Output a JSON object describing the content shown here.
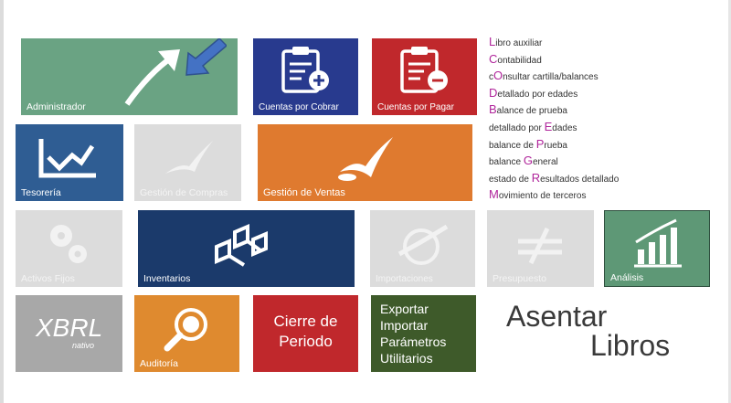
{
  "tiles": {
    "administrador": {
      "label": "Administrador",
      "color": "#6aa383"
    },
    "cuentas_cobrar": {
      "label": "Cuentas por Cobrar",
      "color": "#283a8e"
    },
    "cuentas_pagar": {
      "label": "Cuentas por Pagar",
      "color": "#c0282c"
    },
    "tesoreria": {
      "label": "Tesorería",
      "color": "#2f5d93"
    },
    "gestion_compras": {
      "label": "Gestión de Compras",
      "color": "#dcdcdc"
    },
    "gestion_ventas": {
      "label": "Gestión de Ventas",
      "color": "#df7a2f"
    },
    "activos_fijos": {
      "label": "Activos Fijos",
      "color": "#dcdcdc"
    },
    "inventarios": {
      "label": "Inventarios",
      "color": "#1b3a6b"
    },
    "importaciones": {
      "label": "Importaciones",
      "color": "#dcdcdc"
    },
    "presupuesto": {
      "label": "Presupuesto",
      "color": "#dcdcdc"
    },
    "analisis": {
      "label": "Análisis",
      "color": "#5e9876"
    },
    "xbrl": {
      "label": "XBRL",
      "sublabel": "nativo",
      "color": "#a8a8a8"
    },
    "auditoria": {
      "label": "Auditoría",
      "color": "#df8a2f"
    },
    "cierre": {
      "line1": "Cierre de",
      "line2": "Periodo",
      "color": "#c0282c"
    },
    "exportar": {
      "line1": "Exportar",
      "line2": "Importar",
      "line3": "Parámetros",
      "line4": "Utilitarios",
      "color": "#3e5a2a"
    }
  },
  "shortcuts": [
    {
      "pre": "",
      "key": "L",
      "post": "ibro auxiliar"
    },
    {
      "pre": "",
      "key": "C",
      "post": "ontabilidad"
    },
    {
      "pre": "c",
      "key": "O",
      "post": "nsultar cartilla/balances"
    },
    {
      "pre": "",
      "key": "D",
      "post": "etallado por edades"
    },
    {
      "pre": "",
      "key": "B",
      "post": "alance de prueba"
    },
    {
      "pre": "detallado por ",
      "key": "E",
      "post": "dades"
    },
    {
      "pre": "balance de ",
      "key": "P",
      "post": "rueba"
    },
    {
      "pre": "balance ",
      "key": "G",
      "post": "eneral"
    },
    {
      "pre": "estado de ",
      "key": "R",
      "post": "esultados detallado"
    },
    {
      "pre": "",
      "key": "M",
      "post": "ovimiento de terceros"
    }
  ],
  "asentar": {
    "line1": "Asentar",
    "line2": "Libros"
  },
  "accent_color": "#b0259b"
}
